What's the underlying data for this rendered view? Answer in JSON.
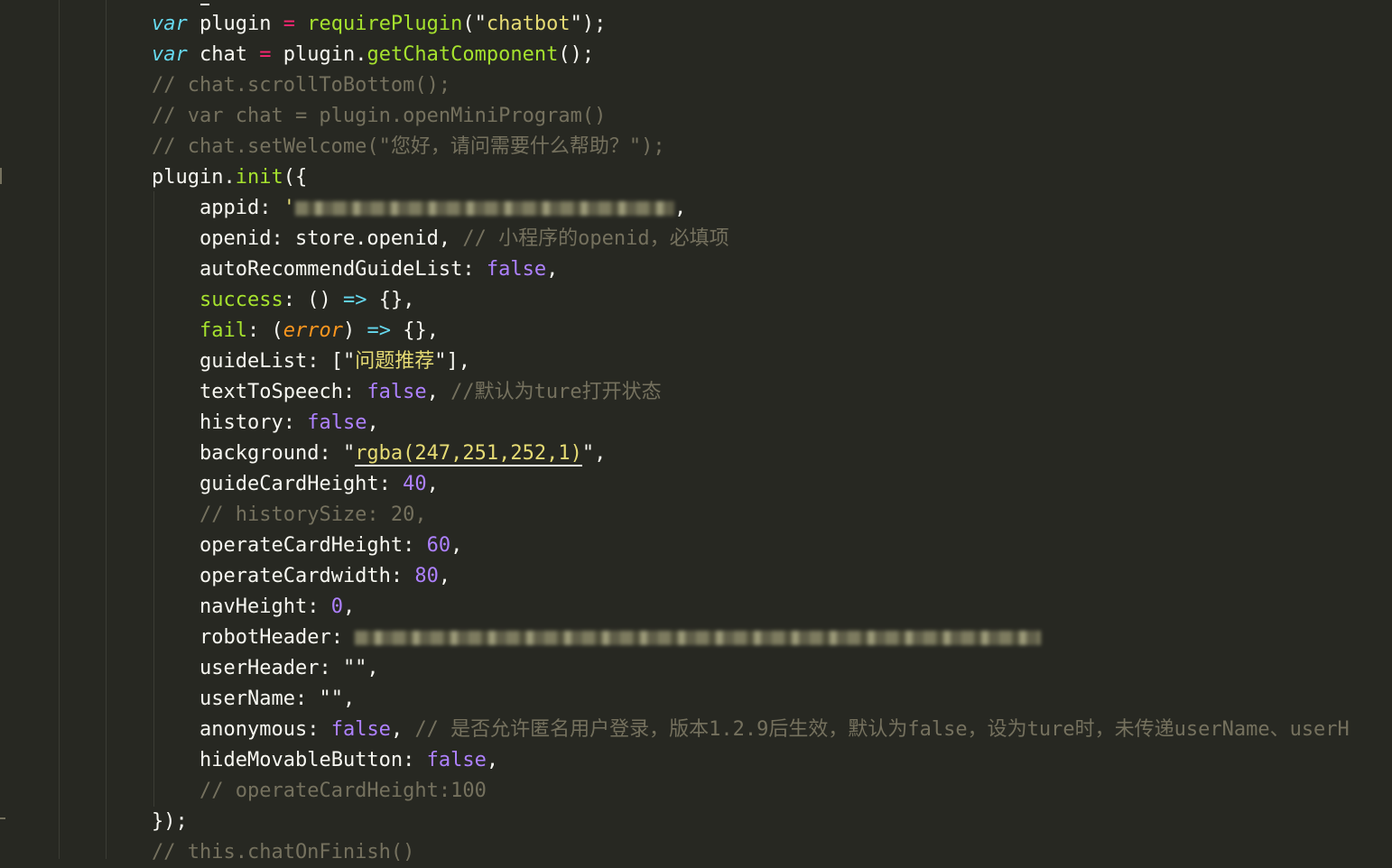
{
  "lines": [
    {
      "indent": 0,
      "tokens": [
        {
          "t": "var",
          "c": "kw"
        },
        {
          "t": " plugin "
        },
        {
          "t": "=",
          "c": "op"
        },
        {
          "t": " "
        },
        {
          "t": "requirePlugin",
          "c": "fn"
        },
        {
          "t": "(\""
        },
        {
          "t": "chatbot",
          "c": "str"
        },
        {
          "t": "\");"
        }
      ]
    },
    {
      "indent": 0,
      "tokens": [
        {
          "t": "var",
          "c": "kw"
        },
        {
          "t": " chat "
        },
        {
          "t": "=",
          "c": "op"
        },
        {
          "t": " plugin."
        },
        {
          "t": "getChatComponent",
          "c": "fn"
        },
        {
          "t": "();"
        }
      ]
    },
    {
      "indent": 0,
      "tokens": [
        {
          "t": "// chat.scrollToBottom();",
          "c": "cmt"
        }
      ]
    },
    {
      "indent": 0,
      "tokens": [
        {
          "t": "// var chat = plugin.openMiniProgram()",
          "c": "cmt"
        }
      ]
    },
    {
      "indent": 0,
      "tokens": [
        {
          "t": "// chat.setWelcome(\"您好，请问需要什么帮助？\");",
          "c": "cmt"
        }
      ]
    },
    {
      "indent": 0,
      "tokens": [
        {
          "t": "plugin."
        },
        {
          "t": "init",
          "c": "fn"
        },
        {
          "t": "({"
        }
      ]
    },
    {
      "indent": 1,
      "tokens": [
        {
          "t": "appid: "
        },
        {
          "t": "'",
          "c": "str"
        },
        {
          "t": "",
          "c": "blur",
          "w": 420
        },
        {
          "t": ","
        }
      ]
    },
    {
      "indent": 1,
      "tokens": [
        {
          "t": "openid: store.openid, "
        },
        {
          "t": "// 小程序的openid，必填项",
          "c": "cmt"
        }
      ]
    },
    {
      "indent": 1,
      "tokens": [
        {
          "t": "autoRecommendGuideList: "
        },
        {
          "t": "false",
          "c": "num"
        },
        {
          "t": ","
        }
      ]
    },
    {
      "indent": 1,
      "tokens": [
        {
          "t": "success",
          "c": "fn"
        },
        {
          "t": ": () "
        },
        {
          "t": "=>",
          "c": "arrow"
        },
        {
          "t": " {},"
        }
      ]
    },
    {
      "indent": 1,
      "tokens": [
        {
          "t": "fail",
          "c": "fn"
        },
        {
          "t": ": ("
        },
        {
          "t": "error",
          "c": "param"
        },
        {
          "t": ") "
        },
        {
          "t": "=>",
          "c": "arrow"
        },
        {
          "t": " {},"
        }
      ]
    },
    {
      "indent": 1,
      "tokens": [
        {
          "t": "guideList: [\""
        },
        {
          "t": "问题推荐",
          "c": "str"
        },
        {
          "t": "\"],"
        }
      ]
    },
    {
      "indent": 1,
      "tokens": [
        {
          "t": "textToSpeech: "
        },
        {
          "t": "false",
          "c": "num"
        },
        {
          "t": ", "
        },
        {
          "t": "//默认为ture打开状态",
          "c": "cmt"
        }
      ]
    },
    {
      "indent": 1,
      "tokens": [
        {
          "t": "history: "
        },
        {
          "t": "false",
          "c": "num"
        },
        {
          "t": ","
        }
      ]
    },
    {
      "indent": 1,
      "tokens": [
        {
          "t": "background: \""
        },
        {
          "t": "rgba(247,251,252,1)",
          "c": "str und"
        },
        {
          "t": "\","
        }
      ]
    },
    {
      "indent": 1,
      "tokens": [
        {
          "t": "guideCardHeight: "
        },
        {
          "t": "40",
          "c": "num"
        },
        {
          "t": ","
        }
      ]
    },
    {
      "indent": 1,
      "tokens": [
        {
          "t": "// historySize: 20,",
          "c": "cmt"
        }
      ]
    },
    {
      "indent": 1,
      "tokens": [
        {
          "t": "operateCardHeight: "
        },
        {
          "t": "60",
          "c": "num"
        },
        {
          "t": ","
        }
      ]
    },
    {
      "indent": 1,
      "tokens": [
        {
          "t": "operateCardwidth: "
        },
        {
          "t": "80",
          "c": "num"
        },
        {
          "t": ","
        }
      ]
    },
    {
      "indent": 1,
      "tokens": [
        {
          "t": "navHeight: "
        },
        {
          "t": "0",
          "c": "num"
        },
        {
          "t": ","
        }
      ]
    },
    {
      "indent": 1,
      "tokens": [
        {
          "t": "robotHeader: "
        },
        {
          "t": "",
          "c": "blur",
          "w": 760
        }
      ]
    },
    {
      "indent": 1,
      "tokens": [
        {
          "t": "userHeader: \"\","
        }
      ]
    },
    {
      "indent": 1,
      "tokens": [
        {
          "t": "userName: \"\","
        }
      ]
    },
    {
      "indent": 1,
      "tokens": [
        {
          "t": "anonymous: "
        },
        {
          "t": "false",
          "c": "num"
        },
        {
          "t": ", "
        },
        {
          "t": "// 是否允许匿名用户登录，版本1.2.9后生效，默认为false，设为ture时，未传递userName、userH",
          "c": "cmt"
        }
      ]
    },
    {
      "indent": 1,
      "tokens": [
        {
          "t": "hideMovableButton: "
        },
        {
          "t": "false",
          "c": "num"
        },
        {
          "t": ","
        }
      ]
    },
    {
      "indent": 1,
      "tokens": [
        {
          "t": "// operateCardHeight:100",
          "c": "cmt"
        }
      ]
    },
    {
      "indent": 0,
      "tokens": [
        {
          "t": "});"
        }
      ]
    },
    {
      "indent": 0,
      "tokens": [
        {
          "t": "// this.chatOnFinish()",
          "c": "cmt"
        }
      ]
    }
  ]
}
